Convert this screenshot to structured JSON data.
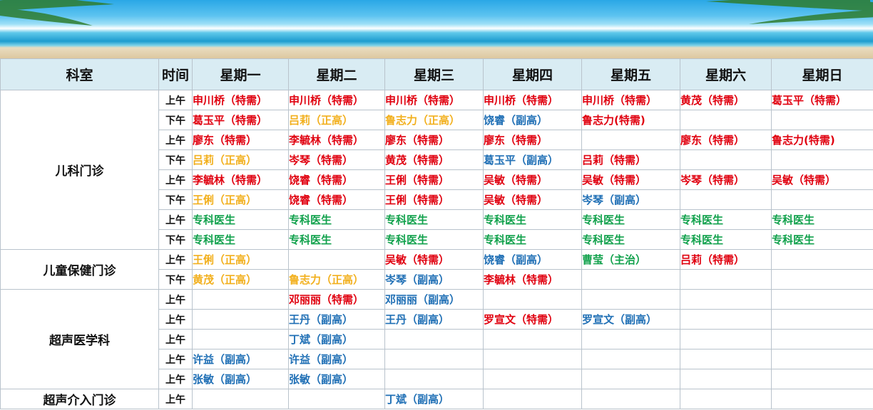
{
  "colors": {
    "red": "#e0000f",
    "yellow": "#f2b01e",
    "blue": "#1f6fb5",
    "green": "#11a14c",
    "header_bg": "#d9ecf3"
  },
  "header": {
    "dept": "科室",
    "time": "时间",
    "days": [
      "星期一",
      "星期二",
      "星期三",
      "星期四",
      "星期五",
      "星期六",
      "星期日"
    ]
  },
  "rows": [
    {
      "dept": "儿科门诊",
      "span": 8,
      "time": "上午",
      "cells": [
        {
          "text": "申川桥（特需）",
          "c": "red"
        },
        {
          "text": "申川桥（特需）",
          "c": "red"
        },
        {
          "text": "申川桥（特需）",
          "c": "red"
        },
        {
          "text": "申川桥（特需）",
          "c": "red"
        },
        {
          "text": "申川桥（特需）",
          "c": "red"
        },
        {
          "text": "黄茂（特需）",
          "c": "red"
        },
        {
          "text": "葛玉平（特需）",
          "c": "red"
        }
      ]
    },
    {
      "time": "下午",
      "cells": [
        {
          "text": "葛玉平（特需）",
          "c": "red"
        },
        {
          "text": "吕莉（正高）",
          "c": "yellow"
        },
        {
          "text": "鲁志力（正高）",
          "c": "yellow"
        },
        {
          "text": "饶睿（副高）",
          "c": "blue"
        },
        {
          "text": "鲁志力(特需)",
          "c": "red"
        },
        {
          "text": "",
          "c": ""
        },
        {
          "text": "",
          "c": ""
        }
      ]
    },
    {
      "time": "上午",
      "cells": [
        {
          "text": "廖东（特需）",
          "c": "red"
        },
        {
          "text": "李毓林（特需）",
          "c": "red"
        },
        {
          "text": "廖东（特需）",
          "c": "red"
        },
        {
          "text": "廖东（特需）",
          "c": "red"
        },
        {
          "text": "",
          "c": ""
        },
        {
          "text": "廖东（特需）",
          "c": "red"
        },
        {
          "text": "鲁志力(特需)",
          "c": "red"
        }
      ]
    },
    {
      "time": "下午",
      "cells": [
        {
          "text": "吕莉（正高）",
          "c": "yellow"
        },
        {
          "text": "岑琴（特需）",
          "c": "red"
        },
        {
          "text": "黄茂（特需）",
          "c": "red"
        },
        {
          "text": "葛玉平（副高）",
          "c": "blue"
        },
        {
          "text": "吕莉（特需）",
          "c": "red"
        },
        {
          "text": "",
          "c": ""
        },
        {
          "text": "",
          "c": ""
        }
      ]
    },
    {
      "time": "上午",
      "cells": [
        {
          "text": "李毓林（特需）",
          "c": "red"
        },
        {
          "text": "饶睿（特需）",
          "c": "red"
        },
        {
          "text": "王俐（特需）",
          "c": "red"
        },
        {
          "text": "吴敏（特需）",
          "c": "red"
        },
        {
          "text": "吴敏（特需）",
          "c": "red"
        },
        {
          "text": "岑琴（特需）",
          "c": "red"
        },
        {
          "text": "吴敏（特需）",
          "c": "red"
        }
      ]
    },
    {
      "time": "下午",
      "cells": [
        {
          "text": "王俐（正高）",
          "c": "yellow"
        },
        {
          "text": "饶睿（特需）",
          "c": "red"
        },
        {
          "text": "王俐（特需）",
          "c": "red"
        },
        {
          "text": "吴敏（特需）",
          "c": "red"
        },
        {
          "text": "岑琴（副高）",
          "c": "blue"
        },
        {
          "text": "",
          "c": ""
        },
        {
          "text": "",
          "c": ""
        }
      ]
    },
    {
      "time": "上午",
      "cells": [
        {
          "text": "专科医生",
          "c": "green"
        },
        {
          "text": "专科医生",
          "c": "green"
        },
        {
          "text": "专科医生",
          "c": "green"
        },
        {
          "text": "专科医生",
          "c": "green"
        },
        {
          "text": "专科医生",
          "c": "green"
        },
        {
          "text": "专科医生",
          "c": "green"
        },
        {
          "text": "专科医生",
          "c": "green"
        }
      ]
    },
    {
      "time": "下午",
      "cells": [
        {
          "text": "专科医生",
          "c": "green"
        },
        {
          "text": "专科医生",
          "c": "green"
        },
        {
          "text": "专科医生",
          "c": "green"
        },
        {
          "text": "专科医生",
          "c": "green"
        },
        {
          "text": "专科医生",
          "c": "green"
        },
        {
          "text": "专科医生",
          "c": "green"
        },
        {
          "text": "专科医生",
          "c": "green"
        }
      ]
    },
    {
      "dept": "儿童保健门诊",
      "span": 2,
      "time": "上午",
      "cells": [
        {
          "text": "王俐（正高）",
          "c": "yellow"
        },
        {
          "text": "",
          "c": ""
        },
        {
          "text": "吴敏（特需）",
          "c": "red"
        },
        {
          "text": "饶睿（副高）",
          "c": "blue"
        },
        {
          "text": "曹莹（主治）",
          "c": "green"
        },
        {
          "text": "吕莉（特需）",
          "c": "red"
        },
        {
          "text": "",
          "c": ""
        }
      ]
    },
    {
      "time": "下午",
      "cells": [
        {
          "text": "黄茂（正高）",
          "c": "yellow"
        },
        {
          "text": "鲁志力（正高）",
          "c": "yellow"
        },
        {
          "text": "岑琴（副高）",
          "c": "blue"
        },
        {
          "text": "李毓林（特需）",
          "c": "red"
        },
        {
          "text": "",
          "c": ""
        },
        {
          "text": "",
          "c": ""
        },
        {
          "text": "",
          "c": ""
        }
      ]
    },
    {
      "dept": "超声医学科",
      "span": 5,
      "time": "上午",
      "cells": [
        {
          "text": "",
          "c": ""
        },
        {
          "text": "邓丽丽（特需）",
          "c": "red"
        },
        {
          "text": "邓丽丽（副高）",
          "c": "blue"
        },
        {
          "text": "",
          "c": ""
        },
        {
          "text": "",
          "c": ""
        },
        {
          "text": "",
          "c": ""
        },
        {
          "text": "",
          "c": ""
        }
      ]
    },
    {
      "time": "上午",
      "cells": [
        {
          "text": "",
          "c": ""
        },
        {
          "text": "王丹（副高）",
          "c": "blue"
        },
        {
          "text": "王丹（副高）",
          "c": "blue"
        },
        {
          "text": "罗宣文（特需）",
          "c": "red"
        },
        {
          "text": "罗宣文（副高）",
          "c": "blue"
        },
        {
          "text": "",
          "c": ""
        },
        {
          "text": "",
          "c": ""
        }
      ]
    },
    {
      "time": "上午",
      "cells": [
        {
          "text": "",
          "c": ""
        },
        {
          "text": "丁斌（副高）",
          "c": "blue"
        },
        {
          "text": "",
          "c": ""
        },
        {
          "text": "",
          "c": ""
        },
        {
          "text": "",
          "c": ""
        },
        {
          "text": "",
          "c": ""
        },
        {
          "text": "",
          "c": ""
        }
      ]
    },
    {
      "time": "上午",
      "cells": [
        {
          "text": "许益（副高）",
          "c": "blue"
        },
        {
          "text": "许益（副高）",
          "c": "blue"
        },
        {
          "text": "",
          "c": ""
        },
        {
          "text": "",
          "c": ""
        },
        {
          "text": "",
          "c": ""
        },
        {
          "text": "",
          "c": ""
        },
        {
          "text": "",
          "c": ""
        }
      ]
    },
    {
      "time": "上午",
      "cells": [
        {
          "text": "张敏（副高）",
          "c": "blue"
        },
        {
          "text": "张敏（副高）",
          "c": "blue"
        },
        {
          "text": "",
          "c": ""
        },
        {
          "text": "",
          "c": ""
        },
        {
          "text": "",
          "c": ""
        },
        {
          "text": "",
          "c": ""
        },
        {
          "text": "",
          "c": ""
        }
      ]
    },
    {
      "dept": "超声介入门诊",
      "span": 1,
      "time": "上午",
      "cells": [
        {
          "text": "",
          "c": ""
        },
        {
          "text": "",
          "c": ""
        },
        {
          "text": "丁斌（副高）",
          "c": "blue"
        },
        {
          "text": "",
          "c": ""
        },
        {
          "text": "",
          "c": ""
        },
        {
          "text": "",
          "c": ""
        },
        {
          "text": "",
          "c": ""
        }
      ]
    }
  ]
}
